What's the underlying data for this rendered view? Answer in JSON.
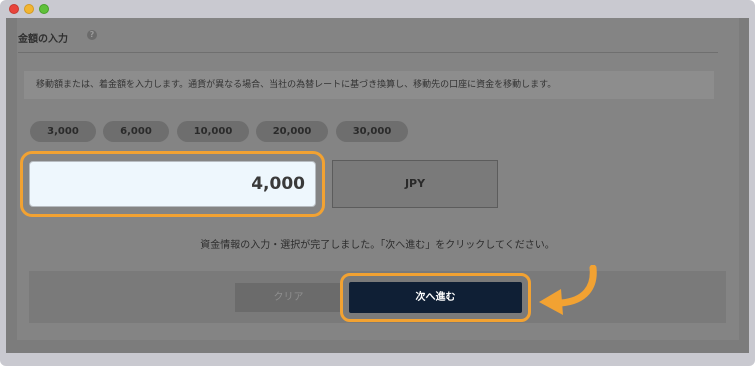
{
  "section": {
    "title": "金額の入力",
    "help_icon": "question-icon"
  },
  "note": "移動額または、着金額を入力します。通貨が異なる場合、当社の為替レートに基づき換算し、移動先の口座に資金を移動します。",
  "presets": [
    "3,000",
    "6,000",
    "10,000",
    "20,000",
    "30,000"
  ],
  "amount": {
    "value": "4,000",
    "highlight_color": "#f2a232"
  },
  "currency": "JPY",
  "instruction": "資金情報の入力・選択が完了しました。「次へ進む」をクリックしてください。",
  "buttons": {
    "clear_label": "クリア",
    "next_label": "次へ進む"
  },
  "colors": {
    "accent": "#f2a232",
    "next_button": "#0f1f35",
    "input_bg": "#eef7fd"
  },
  "window_controls": [
    "close",
    "minimize",
    "maximize"
  ]
}
